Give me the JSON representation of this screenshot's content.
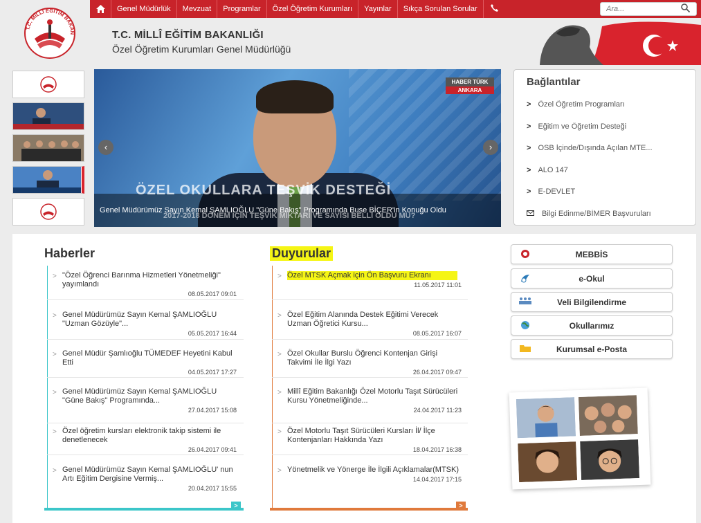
{
  "nav": {
    "items": [
      "Genel Müdürlük",
      "Mevzuat",
      "Programlar",
      "Özel Öğretim Kurumları",
      "Yayınlar",
      "Sıkça Sorulan Sorular"
    ],
    "search_placeholder": "Ara..."
  },
  "header": {
    "logo_text": "T.C. MİLLÎ EĞİTİM BAKANLIĞI",
    "title": "T.C. MİLLÎ EĞİTİM BAKANLIĞI",
    "subtitle": "Özel Öğretim Kurumları Genel Müdürlüğü"
  },
  "slider": {
    "tv_logo": "HABER TÜRK",
    "tv_city": "ANKARA",
    "ticker_big": "ÖZEL OKULLARA TEŞVİK DESTEĞİ",
    "ticker_sub": "2017-2018 DÖNEM İÇİN TEŞVİK MİKTARI VE SAYISI BELLİ OLDU MU?",
    "caption": "Genel Müdürümüz Sayın Kemal ŞAMLIOĞLU \"Güne Bakış\" Programında Buse BİÇER'in Konuğu Oldu"
  },
  "links": {
    "title": "Bağlantılar",
    "items": [
      "Özel Öğretim Programları",
      "Eğitim ve Öğretim Desteği",
      "OSB İçinde/Dışında Açılan MTE...",
      "ALO 147",
      "E-DEVLET",
      "Bilgi Edinme/BİMER Başvuruları"
    ]
  },
  "haberler": {
    "title": "Haberler",
    "items": [
      {
        "text": "\"Özel Öğrenci Barınma Hizmetleri Yönetmeliği\" yayımlandı",
        "date": "08.05.2017 09:01"
      },
      {
        "text": "Genel Müdürümüz Sayın Kemal ŞAMLIOĞLU \"Uzman Gözüyle\"...",
        "date": "05.05.2017 16:44"
      },
      {
        "text": "Genel Müdür Şamlıoğlu TÜMEDEF Heyetini Kabul Etti",
        "date": "04.05.2017 17:27"
      },
      {
        "text": "Genel Müdürümüz Sayın Kemal ŞAMLIOĞLU \"Güne Bakış\" Programında...",
        "date": "27.04.2017 15:08"
      },
      {
        "text": "Özel öğretim kursları elektronik takip sistemi ile denetlenecek",
        "date": "26.04.2017 09:41"
      },
      {
        "text": "Genel Müdürümüz Sayın Kemal ŞAMLIOĞLU' nun Artı Eğitim Dergisine Vermiş...",
        "date": "20.04.2017 15:55"
      }
    ]
  },
  "duyurular": {
    "title": "Duyurular",
    "items": [
      {
        "text": "Özel MTSK Açmak için Ön Başvuru Ekranı",
        "date": "11.05.2017 11:01"
      },
      {
        "text": "Özel Eğitim Alanında Destek Eğitimi Verecek Uzman Öğretici Kursu...",
        "date": "08.05.2017 16:07"
      },
      {
        "text": "Özel Okullar Burslu Öğrenci Kontenjan Girişi Takvimi İle İlgi Yazı",
        "date": "26.04.2017 09:47"
      },
      {
        "text": "Millî Eğitim Bakanlığı Özel Motorlu Taşıt Sürücüleri Kursu Yönetmeliğinde...",
        "date": "24.04.2017 11:23"
      },
      {
        "text": "Özel Motorlu Taşıt Sürücüleri Kursları İl/ İlçe Kontenjanları Hakkında Yazı",
        "date": "18.04.2017 16:38"
      },
      {
        "text": "Yönetmelik ve Yönerge İle İlgili Açıklamalar(MTSK)",
        "date": "14.04.2017 17:15"
      }
    ]
  },
  "quick_links": [
    "MEBBİS",
    "e-Okul",
    "Veli Bilgilendirme",
    "Okullarımız",
    "Kurumsal e-Posta"
  ],
  "colors": {
    "nav_red": "#c8232a",
    "haber_accent": "#3cc6c9",
    "duyuru_accent": "#e07a3c",
    "highlight": "#f5f515"
  }
}
